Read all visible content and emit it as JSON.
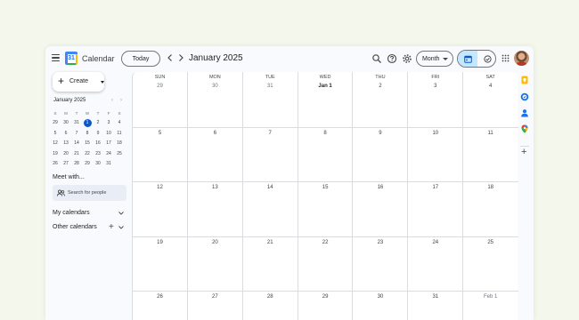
{
  "header": {
    "app_title": "Calendar",
    "logo_number": "31",
    "today_label": "Today",
    "month_title": "January 2025",
    "view_label": "Month",
    "icons": [
      "menu-icon",
      "search-icon",
      "help-icon",
      "settings-icon",
      "calendar-view-icon",
      "tasks-view-icon",
      "apps-grid-icon"
    ]
  },
  "sidebar": {
    "create_label": "Create",
    "mini_calendar": {
      "title": "January 2025",
      "weekdays": [
        "S",
        "M",
        "T",
        "W",
        "T",
        "F",
        "S"
      ],
      "weeks": [
        [
          "29",
          "30",
          "31",
          "1",
          "2",
          "3",
          "4"
        ],
        [
          "5",
          "6",
          "7",
          "8",
          "9",
          "10",
          "11"
        ],
        [
          "12",
          "13",
          "14",
          "15",
          "16",
          "17",
          "18"
        ],
        [
          "19",
          "20",
          "21",
          "22",
          "23",
          "24",
          "25"
        ],
        [
          "26",
          "27",
          "28",
          "29",
          "30",
          "31",
          ""
        ]
      ],
      "selected_day": "1"
    },
    "meet_title": "Meet with...",
    "search_placeholder": "Search for people",
    "my_calendars": "My calendars",
    "other_calendars": "Other calendars"
  },
  "grid": {
    "weekdays": [
      "SUN",
      "MON",
      "TUE",
      "WED",
      "THU",
      "FRI",
      "SAT"
    ],
    "weeks": [
      [
        "29",
        "30",
        "31",
        "Jan 1",
        "2",
        "3",
        "4"
      ],
      [
        "5",
        "6",
        "7",
        "8",
        "9",
        "10",
        "11"
      ],
      [
        "12",
        "13",
        "14",
        "15",
        "16",
        "17",
        "18"
      ],
      [
        "19",
        "20",
        "21",
        "22",
        "23",
        "24",
        "25"
      ],
      [
        "26",
        "27",
        "28",
        "29",
        "30",
        "31",
        "Feb 1"
      ]
    ]
  },
  "side_panel": {
    "icons": [
      "keep-icon",
      "tasks-icon",
      "contacts-icon",
      "maps-icon",
      "add-addon-icon"
    ]
  },
  "colors": {
    "accent": "#0b57d0",
    "toggle_active": "#c2e7ff",
    "background": "#f4f7ec"
  }
}
